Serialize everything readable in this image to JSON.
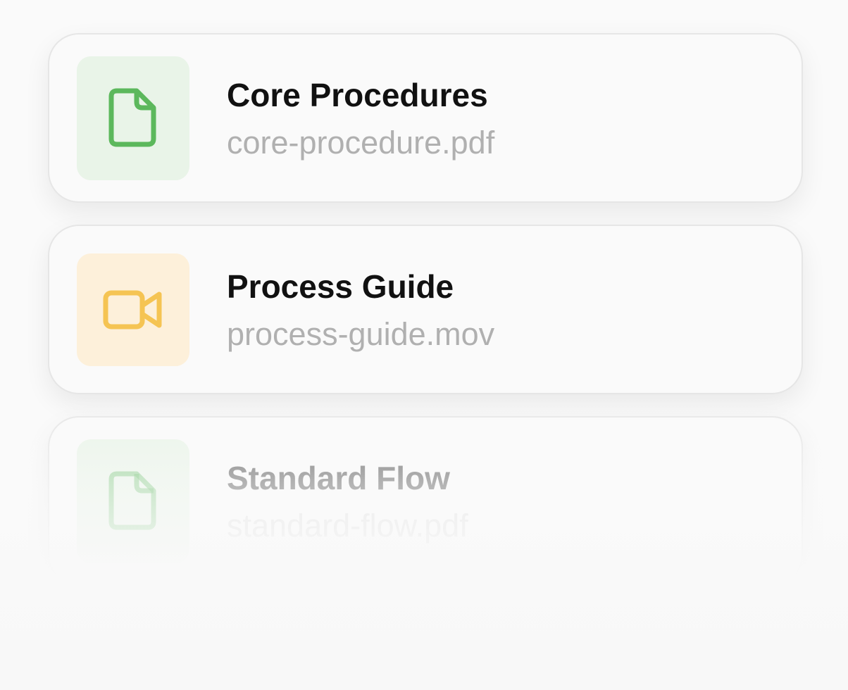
{
  "files": [
    {
      "title": "Core Procedures",
      "filename": "core-procedure.pdf",
      "icon": "document-icon",
      "tile_color": "#e9f4e8",
      "icon_color": "#5cb85c"
    },
    {
      "title": "Process Guide",
      "filename": "process-guide.mov",
      "icon": "video-icon",
      "tile_color": "#fdf0da",
      "icon_color": "#f5c453"
    },
    {
      "title": "Standard Flow",
      "filename": "standard-flow.pdf",
      "icon": "document-icon",
      "tile_color": "#e9f4e8",
      "icon_color": "#5cb85c"
    }
  ]
}
